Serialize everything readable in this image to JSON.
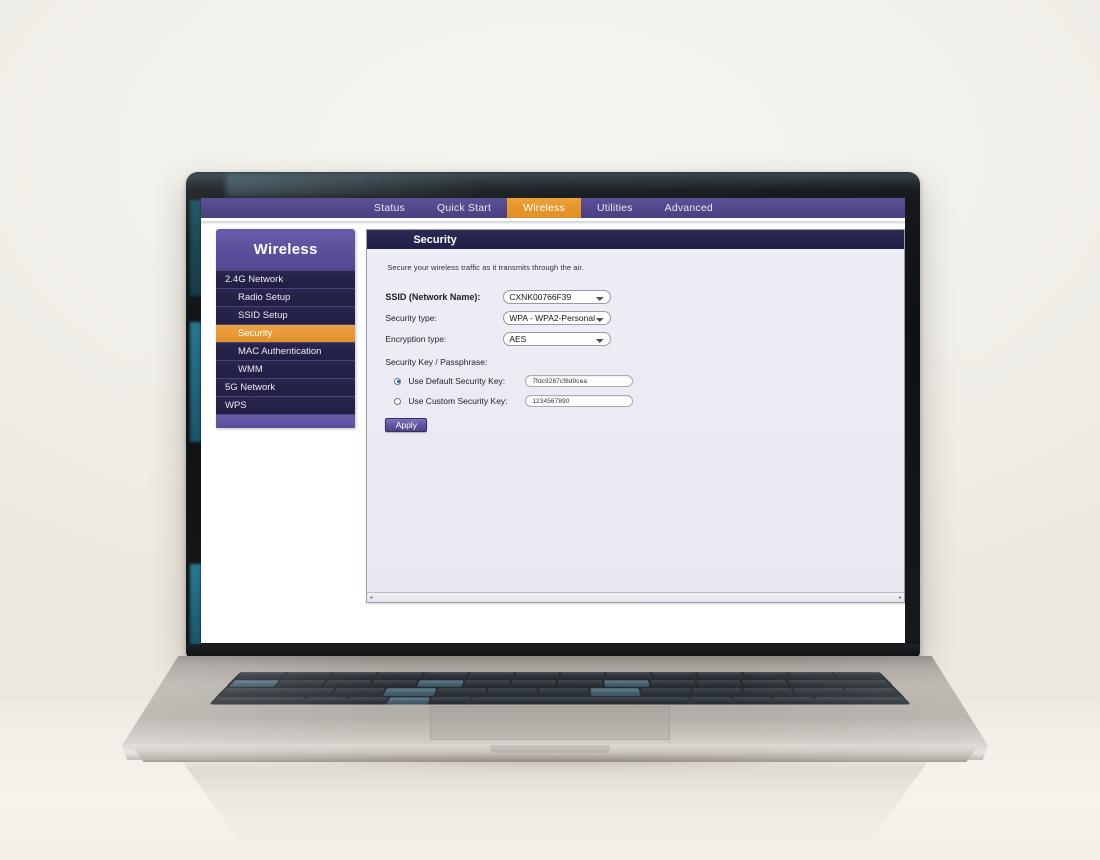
{
  "nav": {
    "tabs": [
      {
        "label": "Status",
        "active": false
      },
      {
        "label": "Quick Start",
        "active": false
      },
      {
        "label": "Wireless",
        "active": true
      },
      {
        "label": "Utilities",
        "active": false
      },
      {
        "label": "Advanced",
        "active": false
      }
    ],
    "active_color": "#e5952b",
    "bar_color": "#564a8e"
  },
  "sidebar": {
    "title": "Wireless",
    "items": [
      {
        "label": "2.4G Network",
        "sub": false,
        "active": false
      },
      {
        "label": "Radio Setup",
        "sub": true,
        "active": false
      },
      {
        "label": "SSID Setup",
        "sub": true,
        "active": false
      },
      {
        "label": "Security",
        "sub": true,
        "active": true
      },
      {
        "label": "MAC Authentication",
        "sub": true,
        "active": false
      },
      {
        "label": "WMM",
        "sub": true,
        "active": false
      },
      {
        "label": "5G Network",
        "sub": false,
        "active": false
      },
      {
        "label": "WPS",
        "sub": false,
        "active": false
      }
    ]
  },
  "content": {
    "header": "Security",
    "intro": "Secure your wireless traffic as it transmits through the air.",
    "fields": [
      {
        "label": "SSID (Network Name):",
        "value": "CXNK00766F39",
        "bold": true
      },
      {
        "label": "Security type:",
        "value": "WPA - WPA2-Personal",
        "bold": false
      },
      {
        "label": "Encryption type:",
        "value": "AES",
        "bold": false
      }
    ],
    "key_section_label": "Security Key / Passphrase:",
    "key_options": [
      {
        "label": "Use Default Security Key:",
        "value": "7fdc9287cf8d9cea",
        "selected": true
      },
      {
        "label": "Use Custom Security Key:",
        "value": "1234567890",
        "selected": false
      }
    ],
    "apply_label": "Apply",
    "scroll_left": "◂",
    "scroll_right": "▸"
  }
}
